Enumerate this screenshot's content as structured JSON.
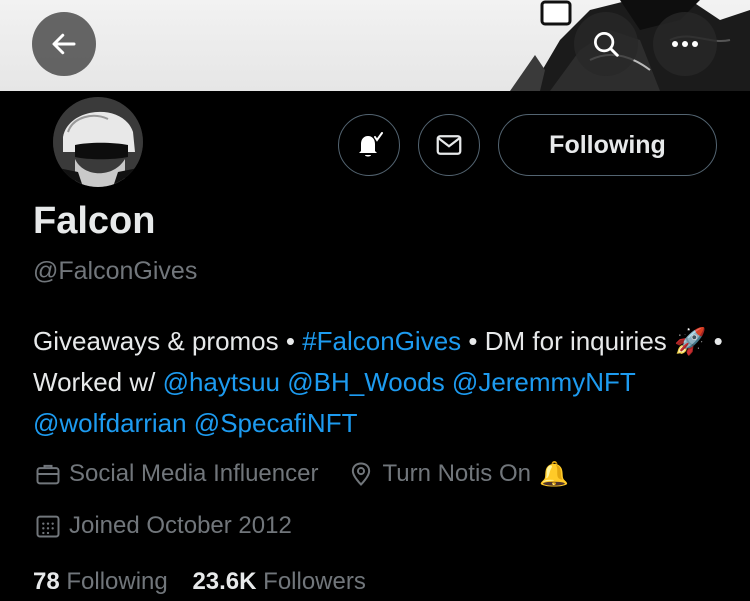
{
  "profile": {
    "name": "Falcon",
    "handle": "@FalconGives",
    "bio": {
      "part1": "Giveaways & promos • ",
      "hashtag": "#FalconGives",
      "part2": " • DM for inquiries ",
      "rocket": "🚀",
      "part3": " • Worked w/ ",
      "mentions": [
        "@haytsuu",
        "@BH_Woods",
        "@JeremmyNFT",
        "@wolfdarrian",
        "@SpecafiNFT"
      ]
    },
    "category": "Social Media Influencer",
    "location": "Turn Notis On",
    "location_emoji": "🔔",
    "joined": "Joined October 2012",
    "following_count": "78",
    "following_label": "Following",
    "followers_count": "23.6K",
    "followers_label": "Followers"
  },
  "actions": {
    "following_button": "Following"
  },
  "icons": [
    "back-arrow-icon",
    "search-icon",
    "more-icon",
    "notification-bell-icon",
    "mail-icon",
    "briefcase-icon",
    "location-pin-icon",
    "calendar-icon"
  ],
  "colors": {
    "background": "#000000",
    "link": "#1d9bf0",
    "secondary_text": "#71767b",
    "primary_text": "#e7e9ea",
    "border": "#536471"
  }
}
